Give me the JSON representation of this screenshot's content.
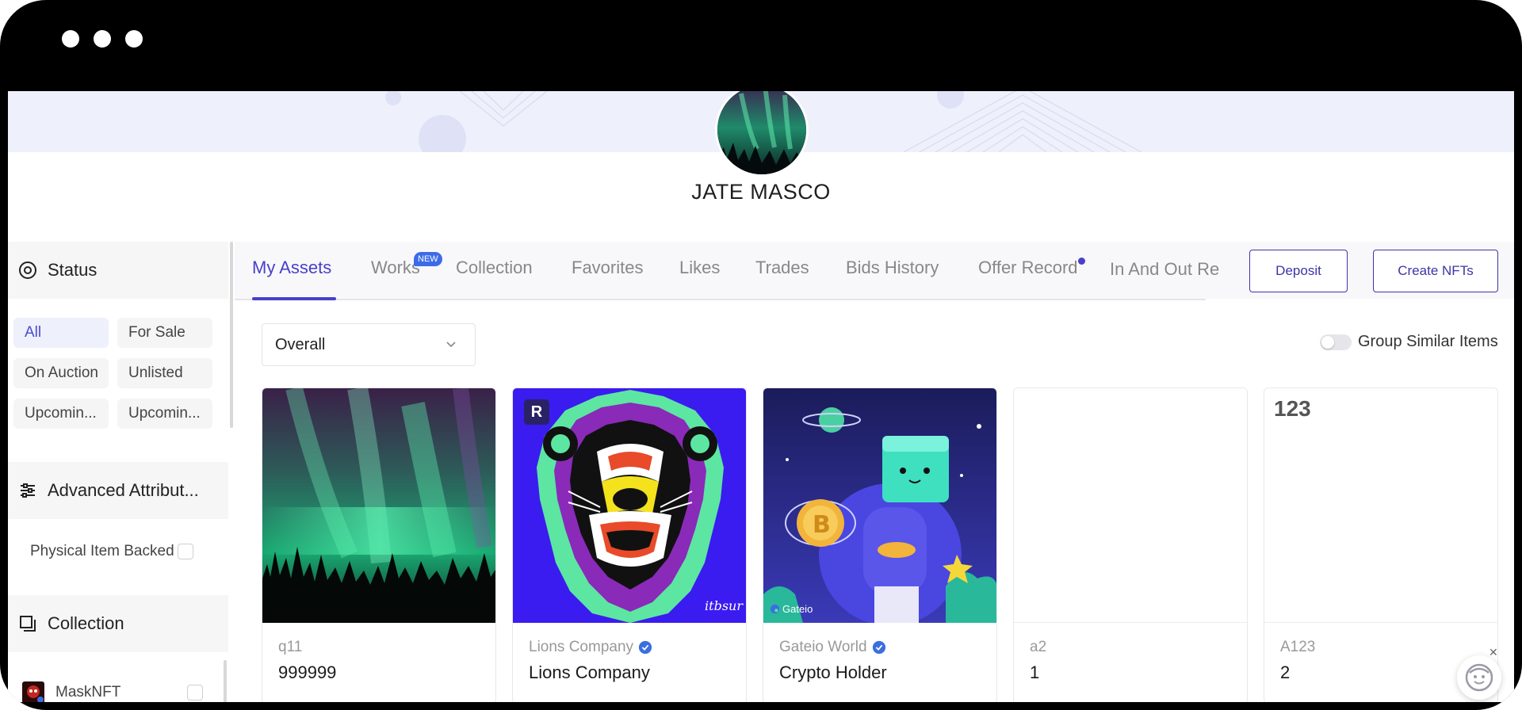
{
  "profile": {
    "name": "JATE MASCO"
  },
  "sidebar": {
    "status": {
      "title": "Status",
      "filters": [
        "All",
        "For Sale",
        "On Auction",
        "Unlisted",
        "Upcomin...",
        "Upcomin..."
      ],
      "active": "All"
    },
    "advanced": {
      "title": "Advanced Attribut...",
      "option": "Physical Item Backed"
    },
    "collection": {
      "title": "Collection",
      "items": [
        "MaskNFT"
      ]
    }
  },
  "tabs": {
    "items": [
      "My Assets",
      "Works",
      "Collection",
      "Favorites",
      "Likes",
      "Trades",
      "Bids History",
      "Offer Record",
      "In And Out Re"
    ],
    "active": "My Assets",
    "works_badge": "NEW"
  },
  "actions": {
    "deposit": "Deposit",
    "create": "Create NFTs"
  },
  "filter": {
    "select_value": "Overall",
    "group_toggle_label": "Group Similar Items",
    "group_toggle_on": false
  },
  "cards": [
    {
      "collection": "q11",
      "title": "999999",
      "verified": false
    },
    {
      "collection": "Lions Company",
      "title": "Lions Company",
      "verified": true,
      "corner_badge": "R",
      "signature": "itbsur"
    },
    {
      "collection": "Gateio World",
      "title": "Crypto Holder",
      "verified": true,
      "watermark": "Gateio"
    },
    {
      "collection": "a2",
      "title": "1",
      "verified": false
    },
    {
      "collection": "A123",
      "title": "2",
      "verified": false,
      "image_text": "123"
    }
  ],
  "colors": {
    "accent": "#4840c8",
    "badge_blue": "#3d6be8",
    "verified_blue": "#3b6fe0"
  }
}
